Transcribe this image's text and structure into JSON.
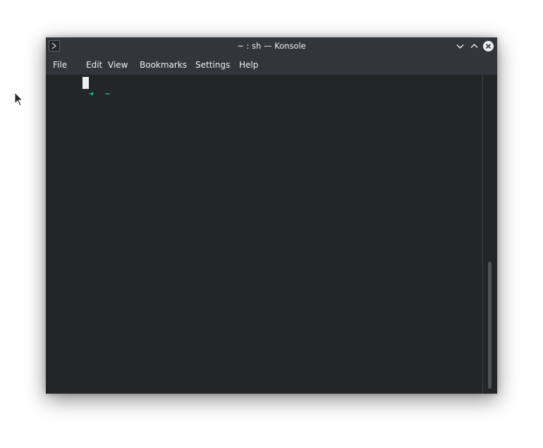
{
  "window": {
    "title": "~ : sh — Konsole",
    "app_icon": "konsole-icon"
  },
  "titlebar_buttons": {
    "minimize": "chevron-down-icon",
    "maximize": "chevron-up-icon",
    "close": "close-icon"
  },
  "menu": {
    "items": [
      "File",
      "Edit",
      "View",
      "Bookmarks",
      "Settings",
      "Help"
    ]
  },
  "terminal": {
    "prompt_arrow": "➜",
    "prompt_dir": "~",
    "prompt_arrow_color": "#1cdc9a",
    "background_color": "#232627",
    "foreground_color": "#eff0f1"
  }
}
